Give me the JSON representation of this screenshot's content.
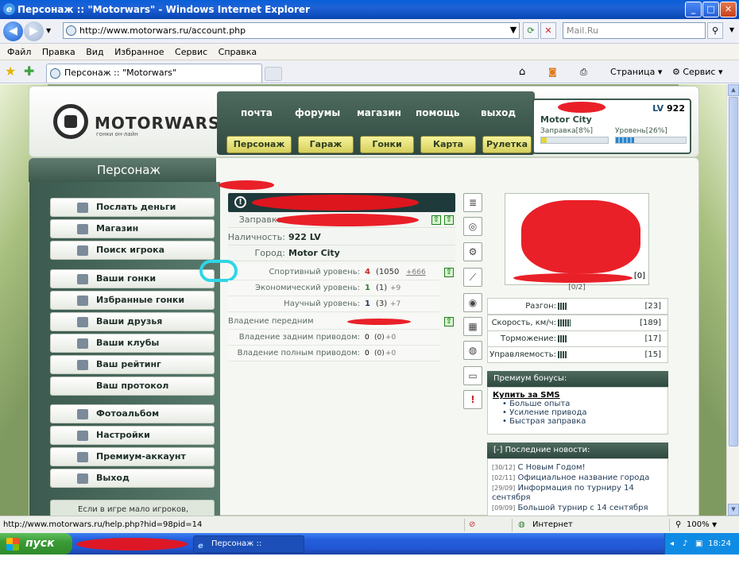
{
  "window": {
    "title": "Персонаж :: \"Motorwars\" - Windows Internet Explorer",
    "min": "_",
    "max": "□",
    "close": "✕"
  },
  "address": {
    "url": "http://www.motorwars.ru/account.php",
    "search_placeholder": "Mail.Ru"
  },
  "menu": [
    "Файл",
    "Правка",
    "Вид",
    "Избранное",
    "Сервис",
    "Справка"
  ],
  "tab": {
    "label": "Персонаж :: \"Motorwars\""
  },
  "toolbar": {
    "page": "Страница",
    "service": "Сервис"
  },
  "site": {
    "logo": "MOTORWARS.RU",
    "logo_sub": "гонки он-лайн",
    "nav_top": [
      "почта",
      "форумы",
      "магазин",
      "помощь",
      "выход"
    ],
    "nav_bottom": [
      "Персонаж",
      "Гараж",
      "Гонки",
      "Карта",
      "Рулетка"
    ],
    "user": {
      "lv": "LV",
      "lv_value": "922",
      "city": "Motor City",
      "fuel_label": "Заправка[8%]",
      "fuel": 0.08,
      "level_label": "Уровень[26%]",
      "level": 0.26
    }
  },
  "panel": {
    "title": "Персонаж",
    "menu": [
      {
        "label": "Послать деньги",
        "icon": "money-icon"
      },
      {
        "label": "Магазин",
        "icon": "shop-icon"
      },
      {
        "label": "Поиск игрока",
        "icon": "search-icon"
      },
      {
        "label": "Ваши гонки",
        "icon": "steering-wheel-icon"
      },
      {
        "label": "Избранные гонки",
        "icon": "favorites-icon"
      },
      {
        "label": "Ваши друзья",
        "icon": "friends-icon"
      },
      {
        "label": "Ваши клубы",
        "icon": "clubs-icon"
      },
      {
        "label": "Ваш рейтинг",
        "icon": "rating-icon"
      },
      {
        "label": "Ваш протокол",
        "icon": ""
      },
      {
        "label": "Фотоальбом",
        "icon": "photo-icon"
      },
      {
        "label": "Настройки",
        "icon": "settings-icon"
      },
      {
        "label": "Премиум-аккаунт",
        "icon": "premium-icon"
      },
      {
        "label": "Выход",
        "icon": "exit-icon"
      }
    ],
    "tip": "Если в игре мало игроков,"
  },
  "info": {
    "fuel_key": "Заправка:",
    "cash_key": "Наличность:",
    "cash_value": "922 LV",
    "city_key": "Город:",
    "city_value": "Motor City"
  },
  "levels": [
    {
      "key": "Спортивный уровень:",
      "value": "4",
      "detail": "(1050",
      "extra": "+666"
    },
    {
      "key": "Экономический уровень:",
      "value": "1",
      "detail": "(1)",
      "extra": "+9"
    },
    {
      "key": "Научный уровень:",
      "value": "1",
      "detail": "(3)",
      "extra": "+7"
    }
  ],
  "drives": [
    {
      "key": "Владение передним приводом:",
      "value": "",
      "detail": "",
      "extra": ""
    },
    {
      "key": "Владение задним приводом:",
      "value": "0",
      "detail": "(0)",
      "extra": "+0"
    },
    {
      "key": "Владение полным приводом:",
      "value": "0",
      "detail": "(0)",
      "extra": "+0"
    }
  ],
  "car": {
    "counter": "[0/2]",
    "extra": "[0]"
  },
  "stats": [
    {
      "key": "Разгон:",
      "value": "[23]",
      "level": 23
    },
    {
      "key": "Скорость, км/ч:",
      "value": "[189]",
      "level": 189
    },
    {
      "key": "Торможение:",
      "value": "[17]",
      "level": 17
    },
    {
      "key": "Управляемость:",
      "value": "[15]",
      "level": 15
    }
  ],
  "premium": {
    "head": "Премиум бонусы:",
    "buy": "Купить за SMS",
    "items": [
      "Больше опыта",
      "Усиление привода",
      "Быстрая заправка"
    ]
  },
  "news": {
    "head": "[-]  Последние новости:",
    "items": [
      {
        "date": "[30/12]",
        "text": "С Новым Годом!"
      },
      {
        "date": "[02/11]",
        "text": "Официальное название города"
      },
      {
        "date": "[29/09]",
        "text": "Информация по турниру 14 сентября"
      },
      {
        "date": "[09/09]",
        "text": "Большой турнир с 14 сентября"
      }
    ]
  },
  "status": {
    "url": "http://www.motorwars.ru/help.php?hid=98pid=14",
    "zone": "Интернет",
    "zoom": "100%"
  },
  "taskbar": {
    "start": "пуск",
    "item": "Персонаж :: \"Motorw...",
    "clock": "18:24"
  }
}
